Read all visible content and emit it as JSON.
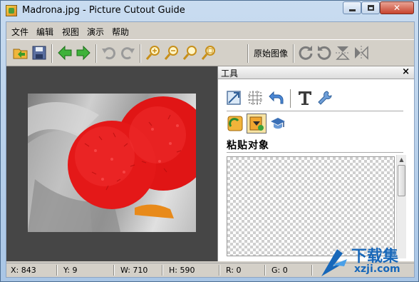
{
  "window": {
    "title": "Madrona.jpg - Picture Cutout Guide"
  },
  "menu": [
    "文件",
    "编辑",
    "视图",
    "演示",
    "帮助"
  ],
  "toolbar": {
    "buttons": [
      "open-icon",
      "save-icon",
      "back-arrow-icon",
      "forward-arrow-icon",
      "undo-icon",
      "redo-icon",
      "zoom-in-icon",
      "zoom-out-icon",
      "zoom-fit-icon",
      "zoom-actual-icon"
    ],
    "original_label": "原始图像",
    "right_buttons": [
      "rotate-right-icon",
      "rotate-left-icon",
      "flip-vertical-icon",
      "flip-horizontal-icon"
    ]
  },
  "panel": {
    "title": "工具",
    "close": "×",
    "paste_title": "粘贴对象"
  },
  "status": {
    "x": "X: 843",
    "y": "Y: 9",
    "w": "W: 710",
    "h": "H: 590",
    "r": "R: 0",
    "g": "G: 0"
  },
  "watermark": {
    "big": "下载集",
    "small": "xzji.com"
  },
  "colors": {
    "accent": "#1767b9",
    "berry": "#e01515"
  }
}
